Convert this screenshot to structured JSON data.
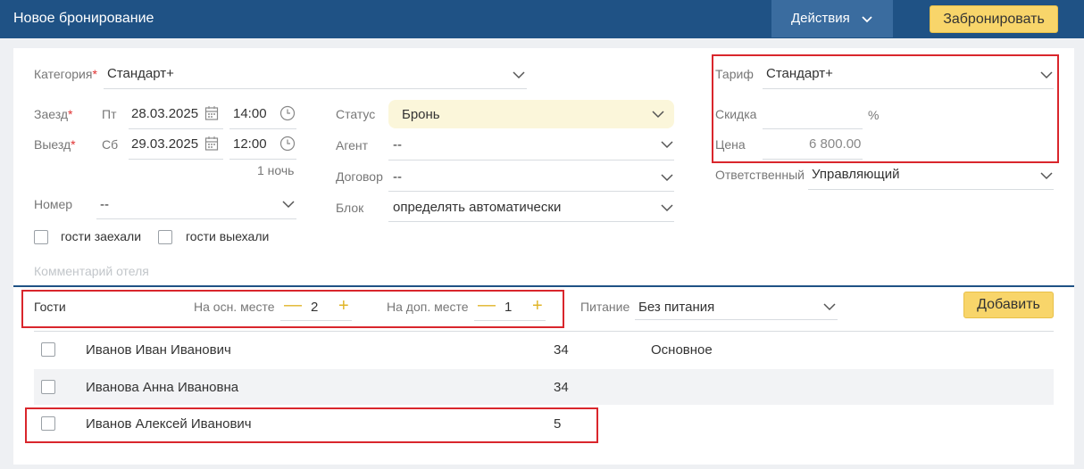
{
  "header": {
    "title": "Новое бронирование",
    "actions_label": "Действия",
    "book_button": "Забронировать"
  },
  "form": {
    "category": {
      "label": "Категория",
      "value": "Стандарт+"
    },
    "checkin": {
      "label": "Заезд",
      "weekday": "Пт",
      "date": "28.03.2025",
      "time": "14:00"
    },
    "checkout": {
      "label": "Выезд",
      "weekday": "Сб",
      "date": "29.03.2025",
      "time": "12:00"
    },
    "nights": "1 ночь",
    "room": {
      "label": "Номер",
      "value": "--"
    },
    "guests_checked_in": "гости заехали",
    "guests_checked_out": "гости выехали",
    "comment_placeholder": "Комментарий отеля",
    "status": {
      "label": "Статус",
      "value": "Бронь"
    },
    "agent": {
      "label": "Агент",
      "value": "--"
    },
    "contract": {
      "label": "Договор",
      "value": "--"
    },
    "block": {
      "label": "Блок",
      "value": "определять автоматически"
    },
    "tariff": {
      "label": "Тариф",
      "value": "Стандарт+"
    },
    "discount": {
      "label": "Скидка",
      "value": "",
      "unit": "%"
    },
    "price": {
      "label": "Цена",
      "value": "6 800.00"
    },
    "responsible": {
      "label": "Ответственный",
      "value": "Управляющий"
    }
  },
  "guests": {
    "label": "Гости",
    "main_place": {
      "label": "На осн. месте",
      "count": "2"
    },
    "extra_place": {
      "label": "На доп. месте",
      "count": "1"
    },
    "meal": {
      "label": "Питание",
      "value": "Без питания"
    },
    "add_button": "Добавить",
    "rows": [
      {
        "name": "Иванов Иван Иванович",
        "age": "34",
        "place": "Основное"
      },
      {
        "name": "Иванова Анна Ивановна",
        "age": "34",
        "place": ""
      },
      {
        "name": "Иванов Алексей Иванович",
        "age": "5",
        "place": ""
      }
    ]
  },
  "icons": {
    "calendar": "calendar-icon",
    "clock": "clock-icon",
    "chevron": "chevron-down-icon",
    "minus": "minus-icon",
    "plus": "plus-icon"
  },
  "colors": {
    "header_bg": "#1f5285",
    "accent_yellow": "#f8d56a",
    "highlight_red": "#d9262c",
    "required_red": "#e03030"
  }
}
